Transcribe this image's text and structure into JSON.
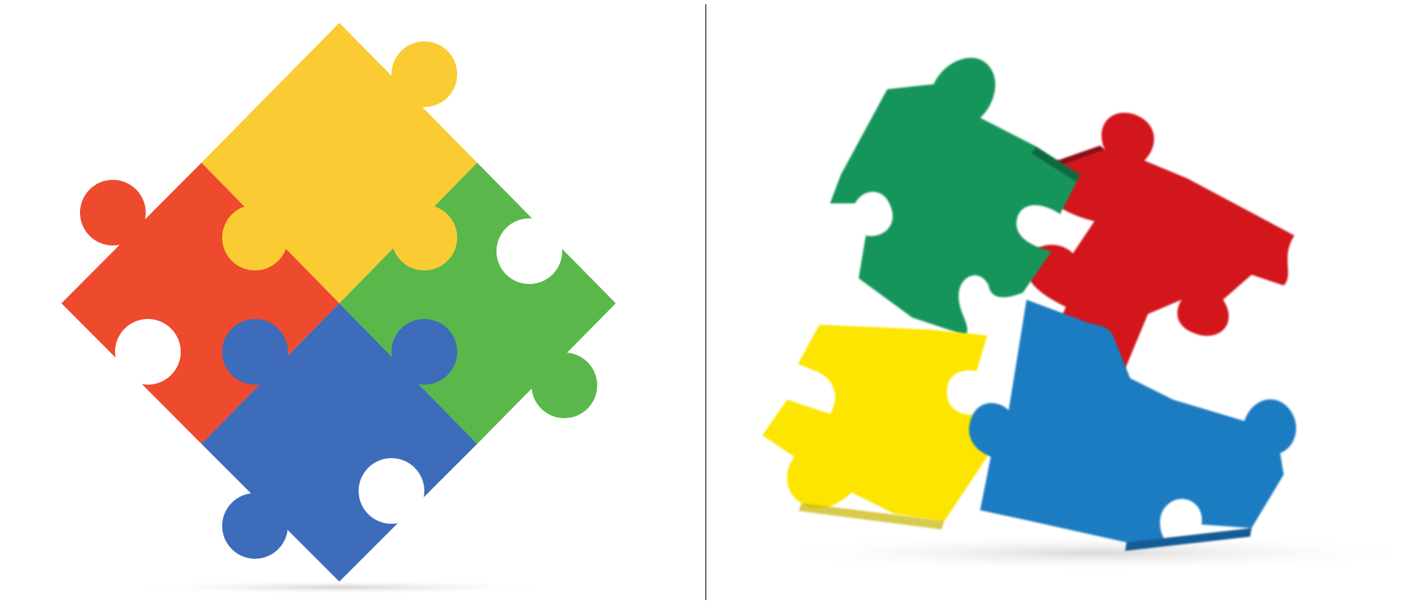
{
  "colors": {
    "background": "#ffffff",
    "divider": "#6b6b6b",
    "flat_yellow": "#FBCB33",
    "flat_red": "#EE4A2D",
    "flat_green": "#5AB84A",
    "flat_blue": "#3D6CBB",
    "photo_green": "#13955A",
    "photo_red": "#D2121D",
    "photo_yellow": "#FCE503",
    "photo_blue": "#1B7BC2"
  },
  "icons": {
    "left": "flat-jigsaw-puzzle-icon",
    "right": "3d-jigsaw-puzzle-pieces-icon"
  },
  "left_pieces": [
    {
      "name": "yellow-puzzle-piece",
      "color_key": "flat_yellow"
    },
    {
      "name": "red-puzzle-piece",
      "color_key": "flat_red"
    },
    {
      "name": "green-puzzle-piece",
      "color_key": "flat_green"
    },
    {
      "name": "blue-puzzle-piece",
      "color_key": "flat_blue"
    }
  ],
  "right_pieces": [
    {
      "name": "green-3d-puzzle-piece",
      "color_key": "photo_green"
    },
    {
      "name": "red-3d-puzzle-piece",
      "color_key": "photo_red"
    },
    {
      "name": "yellow-3d-puzzle-piece",
      "color_key": "photo_yellow"
    },
    {
      "name": "blue-3d-puzzle-piece",
      "color_key": "photo_blue"
    }
  ]
}
